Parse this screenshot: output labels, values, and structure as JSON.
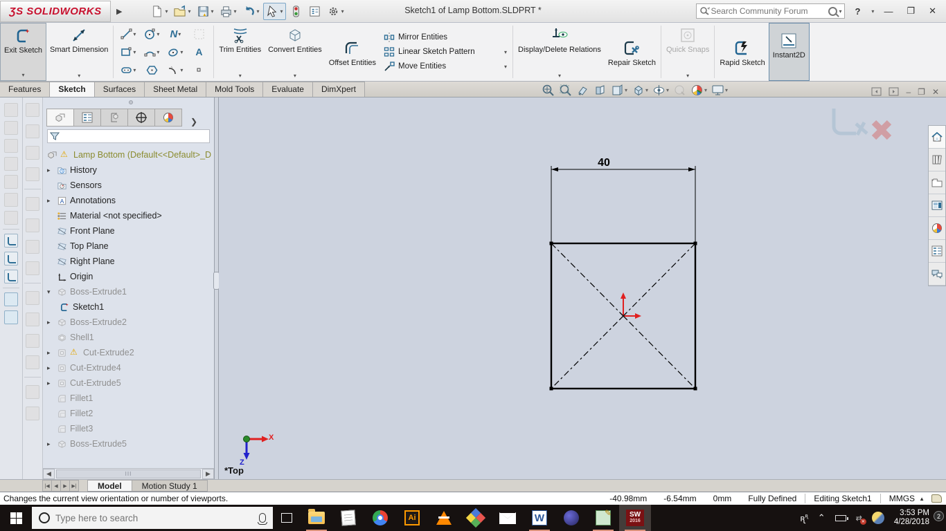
{
  "title_bar": {
    "title": "Sketch1 of Lamp Bottom.SLDPRT *",
    "logo_ds": "ƷS",
    "logo_text": "SOLIDWORKS",
    "search_placeholder": "Search Community Forum",
    "help_label": "?"
  },
  "ribbon": {
    "exit_sketch": "Exit Sketch",
    "smart_dimension": "Smart Dimension",
    "trim_entities": "Trim Entities",
    "convert_entities": "Convert Entities",
    "offset_entities": "Offset Entities",
    "mirror_entities": "Mirror Entities",
    "linear_sketch_pattern": "Linear Sketch Pattern",
    "move_entities": "Move Entities",
    "display_delete_relations": "Display/Delete Relations",
    "repair_sketch": "Repair Sketch",
    "quick_snaps": "Quick Snaps",
    "rapid_sketch": "Rapid Sketch",
    "instant2d": "Instant2D",
    "spline_glyph": "N",
    "text_glyph": "A"
  },
  "command_tabs": {
    "features": "Features",
    "sketch": "Sketch",
    "surfaces": "Surfaces",
    "sheet_metal": "Sheet Metal",
    "mold_tools": "Mold Tools",
    "evaluate": "Evaluate",
    "dimxpert": "DimXpert"
  },
  "feature_tree": {
    "part_name": "Lamp Bottom (Default<<Default>_D",
    "items": [
      {
        "label": "History"
      },
      {
        "label": "Sensors"
      },
      {
        "label": "Annotations"
      },
      {
        "label": "Material <not specified>"
      },
      {
        "label": "Front Plane"
      },
      {
        "label": "Top Plane"
      },
      {
        "label": "Right Plane"
      },
      {
        "label": "Origin"
      },
      {
        "label": "Boss-Extrude1"
      },
      {
        "label": "Sketch1"
      },
      {
        "label": "Boss-Extrude2"
      },
      {
        "label": "Shell1"
      },
      {
        "label": "Cut-Extrude2"
      },
      {
        "label": "Cut-Extrude4"
      },
      {
        "label": "Cut-Extrude5"
      },
      {
        "label": "Fillet1"
      },
      {
        "label": "Fillet2"
      },
      {
        "label": "Fillet3"
      },
      {
        "label": "Boss-Extrude5"
      }
    ],
    "scroll_thumb_glyph": "III"
  },
  "viewport": {
    "dimension_value": "40",
    "view_label": "*Top",
    "axis_x": "X",
    "axis_z": "Z"
  },
  "bottom_tabs": {
    "model": "Model",
    "motion_study": "Motion Study 1"
  },
  "status_bar": {
    "message": "Changes the current view orientation or number of viewports.",
    "coord_x": "-40.98mm",
    "coord_y": "-6.54mm",
    "coord_z": "0mm",
    "sketch_state": "Fully Defined",
    "mode": "Editing Sketch1",
    "units": "MMGS"
  },
  "taskbar": {
    "search_placeholder": "Type here to search",
    "time": "3:53 PM",
    "date": "4/28/2018",
    "notification_count": "2",
    "illustrator_label": "Ai",
    "word_label": "W",
    "solidworks_label": "SW",
    "solidworks_year": "2016"
  },
  "colors": {
    "accent_steel_blue": "#2e6e96",
    "logo_red": "#c8102e",
    "warning_yellow": "#e3a600",
    "sketch_line": "#000000",
    "origin_red": "#e02020",
    "triad_green": "#2a8a2a",
    "triad_blue": "#2222cc",
    "viewport_bg": "#cdd3df",
    "taskbar_underline": "#d9917a"
  }
}
